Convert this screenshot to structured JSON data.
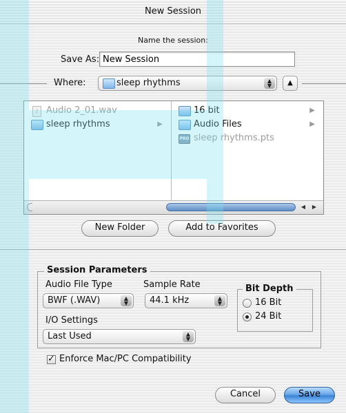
{
  "window": {
    "title": "New Session"
  },
  "save_as": {
    "prompt": "Name the session:",
    "label": "Save As:",
    "value": "New Session"
  },
  "where": {
    "label": "Where:",
    "value": "sleep rhythms"
  },
  "browser": {
    "column1": [
      {
        "name": "Audio 2_01.wav",
        "kind": "file",
        "enabled": false,
        "has_children": false
      },
      {
        "name": "sleep rhythms",
        "kind": "folder",
        "enabled": true,
        "selected": true,
        "has_children": true
      }
    ],
    "column2": [
      {
        "name": "16 bit",
        "kind": "folder",
        "enabled": true,
        "has_children": true
      },
      {
        "name": "Audio Files",
        "kind": "folder",
        "enabled": true,
        "has_children": true
      },
      {
        "name": "sleep rhythms.pts",
        "kind": "session-file",
        "enabled": false,
        "has_children": false
      }
    ]
  },
  "buttons": {
    "new_folder": "New Folder",
    "add_favorites": "Add to Favorites",
    "cancel": "Cancel",
    "save": "Save"
  },
  "params": {
    "heading": "Session Parameters",
    "audio_file_type_label": "Audio File Type",
    "audio_file_type_value": "BWF (.WAV)",
    "sample_rate_label": "Sample Rate",
    "sample_rate_value": "44.1 kHz",
    "bit_depth_label": "Bit Depth",
    "bit_depth_options": [
      "16 Bit",
      "24 Bit"
    ],
    "bit_depth_selected": "24 Bit",
    "io_label": "I/O Settings",
    "io_value": "Last Used",
    "compat_label": "Enforce Mac/PC Compatibility",
    "compat_checked": true
  },
  "colors": {
    "overlay": "#78e1eb",
    "default_button": "#3c84d6"
  }
}
